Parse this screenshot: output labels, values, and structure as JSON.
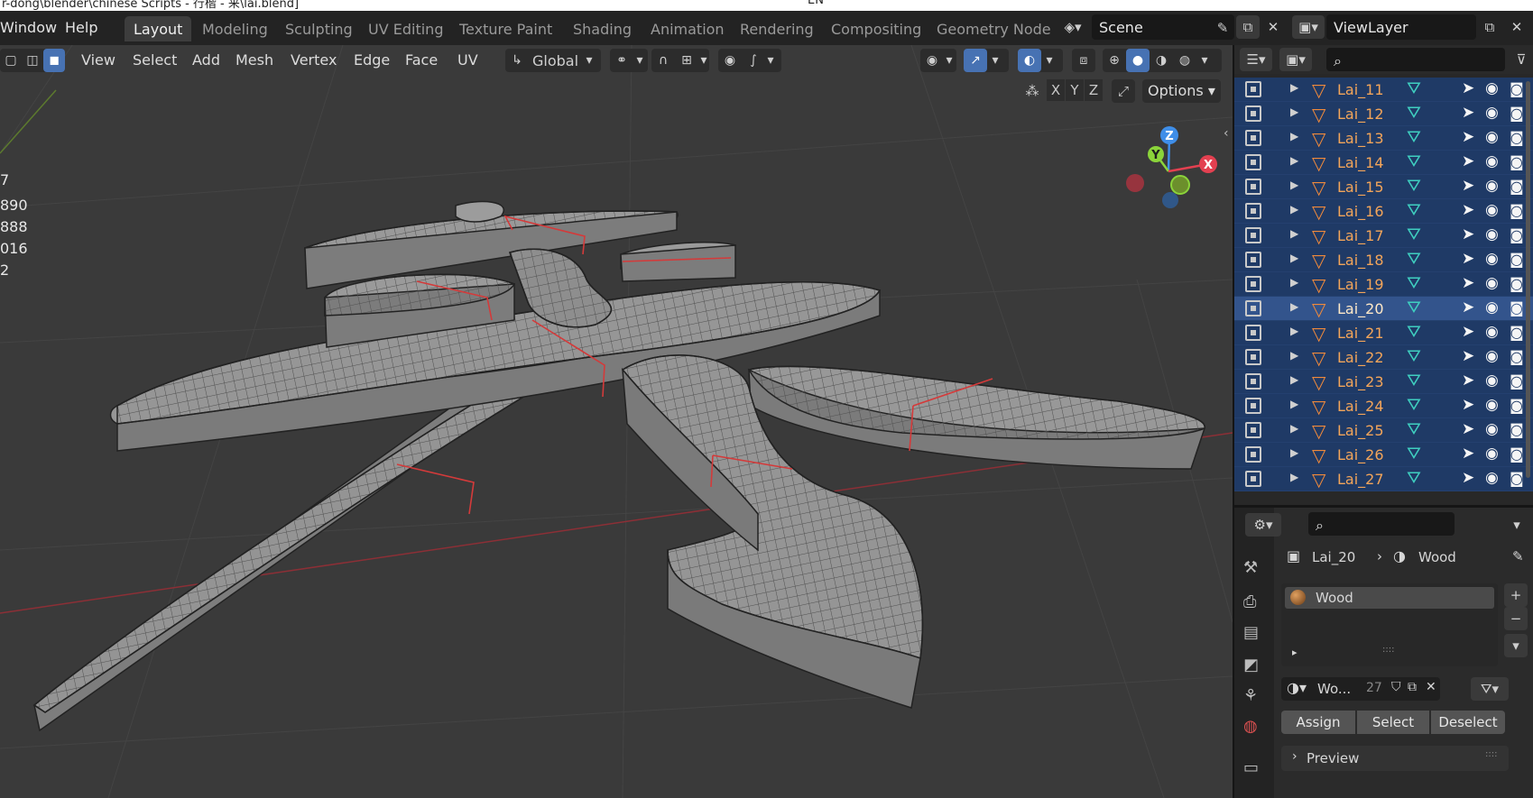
{
  "title_strip": {
    "left": "r-dong\\blender\\chinese Scripts - 行楷 - 来\\lai.blend]",
    "mid": "EN"
  },
  "menus": [
    "Window",
    "Help"
  ],
  "workspaces": [
    "Layout",
    "Modeling",
    "Sculpting",
    "UV Editing",
    "Texture Paint",
    "Shading",
    "Animation",
    "Rendering",
    "Compositing",
    "Geometry Node"
  ],
  "active_workspace": "Layout",
  "scene_field": "Scene",
  "viewlayer_field": "ViewLayer",
  "viewport_header": {
    "menus": [
      "View",
      "Select",
      "Add",
      "Mesh",
      "Vertex",
      "Edge",
      "Face",
      "UV"
    ],
    "transform_orientation": "Global",
    "options_label": "Options",
    "axis_buttons": [
      "X",
      "Y",
      "Z"
    ]
  },
  "stats": [
    "7",
    "890",
    "888",
    "016",
    "2"
  ],
  "gizmo": {
    "z": "Z",
    "y": "Y",
    "x": "X"
  },
  "outliner": {
    "rows": [
      {
        "name": "Lai_11",
        "active": false
      },
      {
        "name": "Lai_12",
        "active": false
      },
      {
        "name": "Lai_13",
        "active": false
      },
      {
        "name": "Lai_14",
        "active": false
      },
      {
        "name": "Lai_15",
        "active": false
      },
      {
        "name": "Lai_16",
        "active": false
      },
      {
        "name": "Lai_17",
        "active": false
      },
      {
        "name": "Lai_18",
        "active": false
      },
      {
        "name": "Lai_19",
        "active": false
      },
      {
        "name": "Lai_20",
        "active": true
      },
      {
        "name": "Lai_21",
        "active": false
      },
      {
        "name": "Lai_22",
        "active": false
      },
      {
        "name": "Lai_23",
        "active": false
      },
      {
        "name": "Lai_24",
        "active": false
      },
      {
        "name": "Lai_25",
        "active": false
      },
      {
        "name": "Lai_26",
        "active": false
      },
      {
        "name": "Lai_27",
        "active": false
      }
    ]
  },
  "properties": {
    "breadcrumb_object": "Lai_20",
    "breadcrumb_material": "Wood",
    "material_slot": "Wood",
    "material_name": "Wo...",
    "user_count": "27",
    "assign_label": "Assign",
    "select_label": "Select",
    "deselect_label": "Deselect",
    "preview_label": "Preview"
  },
  "colors": {
    "accent_blue": "#4772b3",
    "selection_row": "#1f3a66",
    "mesh_orange": "#f08a3c",
    "material_teal": "#3fcfc0",
    "axis_red": "#e34050",
    "axis_green": "#8bd43a",
    "axis_blue": "#3f8ee8"
  }
}
